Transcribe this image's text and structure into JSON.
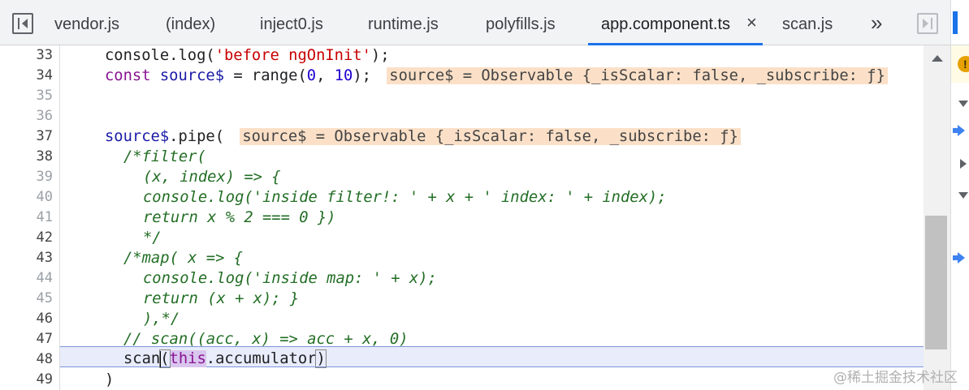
{
  "tabs": [
    {
      "label": "vendor.js"
    },
    {
      "label": "(index)"
    },
    {
      "label": "inject0.js"
    },
    {
      "label": "runtime.js"
    },
    {
      "label": "polyfills.js"
    },
    {
      "label": "app.component.ts",
      "active": true
    },
    {
      "label": "scan.js"
    }
  ],
  "tab_close_glyph": "×",
  "tab_more_glyph": "»",
  "line_numbers": [
    "33",
    "34",
    "35",
    "36",
    "37",
    "38",
    "39",
    "40",
    "41",
    "42",
    "43",
    "44",
    "45",
    "46",
    "47",
    "48",
    "49"
  ],
  "code": {
    "l33": {
      "a": "console.log(",
      "b": "'before ngOnInit'",
      "c": ");"
    },
    "l34": {
      "kw": "const",
      "var": "source$",
      "eq": " = range(",
      "n1": "0",
      "sep": ", ",
      "n2": "10",
      "end": ");",
      "inline": "source$ = Observable {_isScalar: false, _subscribe: ƒ}"
    },
    "l37": {
      "var": "source$",
      "rest": ".pipe(",
      "inline": "source$ = Observable {_isScalar: false, _subscribe: ƒ}"
    },
    "l38": "/*filter(",
    "l39": "(x, index) => {",
    "l40": "console.log('inside filter!: ' + x + ' index: ' + index);",
    "l41": "return x % 2 === 0 })",
    "l42": "*/",
    "l43": "/*map( x => {",
    "l44": "console.log('inside map: ' + x);",
    "l45": "return (x + x); }",
    "l46": "),*/",
    "l47": "// scan((acc, x) => acc + x, 0)",
    "l48": {
      "fn": "scan",
      "open": "(",
      "kw": "this",
      "rest": ".accumulator",
      "close": ")"
    },
    "l49": ")"
  },
  "watermark": "@稀土掘金技术社区",
  "colors": {
    "accent": "#1a73e8",
    "inline_value_bg": "#fbe0c7",
    "current_line_bg": "#e8ecfb"
  }
}
